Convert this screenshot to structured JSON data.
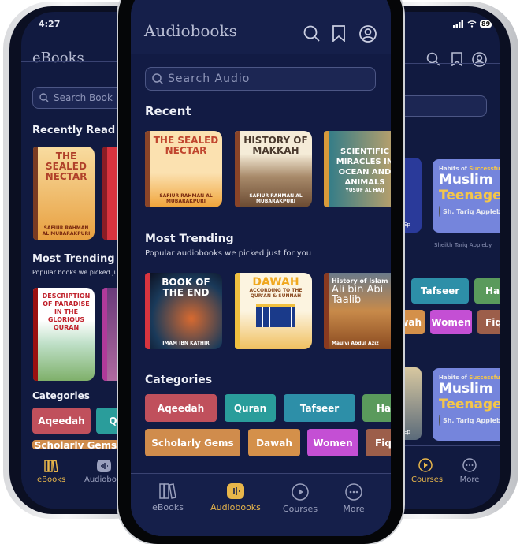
{
  "left_phone": {
    "status_time": "4:27",
    "title": "eBooks",
    "search_placeholder": "Search Book",
    "recently_read": "Recently Read",
    "recent_books": [
      {
        "title": "THE SEALED NECTAR",
        "author": "SAFIUR RAHMAN AL MUBARAKPURI"
      }
    ],
    "most_trending": "Most Trending",
    "trending_subtitle": "Popular books we picked just for you",
    "trending_books": [
      {
        "title": "DESCRIPTION OF PARADISE IN THE GLORIOUS QURAN"
      }
    ],
    "categories": "Categories",
    "chips": [
      "Aqeedah",
      "Quran",
      "Scholarly Gems"
    ],
    "nav": [
      "eBooks",
      "Audiobooks"
    ]
  },
  "center_phone": {
    "title": "Audiobooks",
    "search_placeholder": "Search Audio",
    "recent": "Recent",
    "recent_books": [
      {
        "title": "THE SEALED NECTAR",
        "author": "SAFIUR RAHMAN AL MUBARAKPURI"
      },
      {
        "title": "HISTORY OF MAKKAH",
        "author": "SAFIUR RAHMAN AL MUBARAKPURI"
      },
      {
        "title": "SCIENTIFIC MIRACLES IN OCEAN AND ANIMALS",
        "author": "YUSUF AL HAJJ"
      }
    ],
    "most_trending": "Most Trending",
    "trending_subtitle": "Popular audiobooks we picked just for you",
    "trending_books": [
      {
        "title": "BOOK OF THE END",
        "author": "IMAM IBN KATHIR"
      },
      {
        "title": "DAWAH",
        "subtitle": "ACCORDING TO THE QUR'AN & SUNNAH"
      },
      {
        "title": "Ali bin Abi Taalib",
        "subtitle": "History of Islam",
        "author": "Maulvi Abdul Aziz"
      }
    ],
    "categories": "Categories",
    "chips": [
      {
        "label": "Aqeedah",
        "color": "#c0505c"
      },
      {
        "label": "Quran",
        "color": "#2a9d9b"
      },
      {
        "label": "Tafseer",
        "color": "#2d8fa8"
      },
      {
        "label": "Hadith",
        "color": "#5a9a5c"
      },
      {
        "label": "Scholarly Gems",
        "color": "#d08c4c"
      },
      {
        "label": "Dawah",
        "color": "#d4904a"
      },
      {
        "label": "Women",
        "color": "#c44fd4"
      },
      {
        "label": "Fiqh",
        "color": "#9c5e4a"
      }
    ],
    "nav": [
      {
        "label": "eBooks",
        "icon": "books-icon"
      },
      {
        "label": "Audiobooks",
        "icon": "audio-icon",
        "active": true
      },
      {
        "label": "Courses",
        "icon": "play-circle-icon"
      },
      {
        "label": "More",
        "icon": "more-icon"
      }
    ],
    "accent": "#e8b64a"
  },
  "right_phone": {
    "battery": "89",
    "course_card": {
      "overline_a": "Habits of ",
      "overline_b": "Successful",
      "line1": "Muslim",
      "line2": "Teenagers",
      "author": "Sh. Tariq Appleby"
    },
    "course_author": "Sheikh Tariq Appleby",
    "ep_label": "Ep",
    "chips": [
      "Tafseer",
      "Hadith",
      "Dawah",
      "Women",
      "Fiqh"
    ],
    "nav": [
      "Courses",
      "More"
    ]
  }
}
